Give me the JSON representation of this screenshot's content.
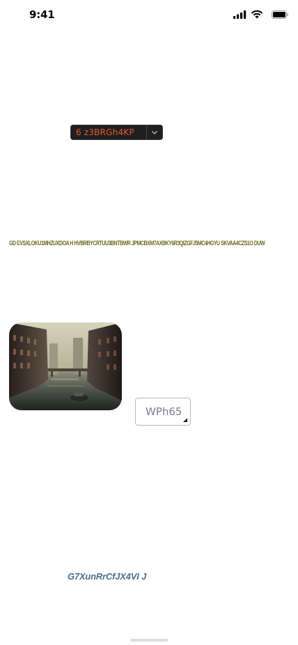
{
  "status_bar": {
    "time": "9:41",
    "icons": [
      "cellular-signal-icon",
      "wifi-icon",
      "battery-icon"
    ]
  },
  "split_button": {
    "label": "6 z3BRGh4KP",
    "toggle_icon": "chevron-down-icon",
    "text_color": "#e65a2e",
    "background": "#1f1f1f"
  },
  "long_text": "GD EVSXLOKU1MHZUXDOA H HVBRBYCRTUU3BNTBWR JPMCBXM7AXBKY6R3QIZGFJ5MC4HGYU SKVAA4CZS1O  DUW",
  "image": {
    "description_icon": "canal-photo"
  },
  "text_field": {
    "value": "WPh65",
    "grip_icon": "resize-grip-icon"
  },
  "italic_text": "G7XunRrCfJX4VI J",
  "colors": {
    "long_text": "#6b6a1e",
    "italic_text": "#4a6f8a"
  }
}
